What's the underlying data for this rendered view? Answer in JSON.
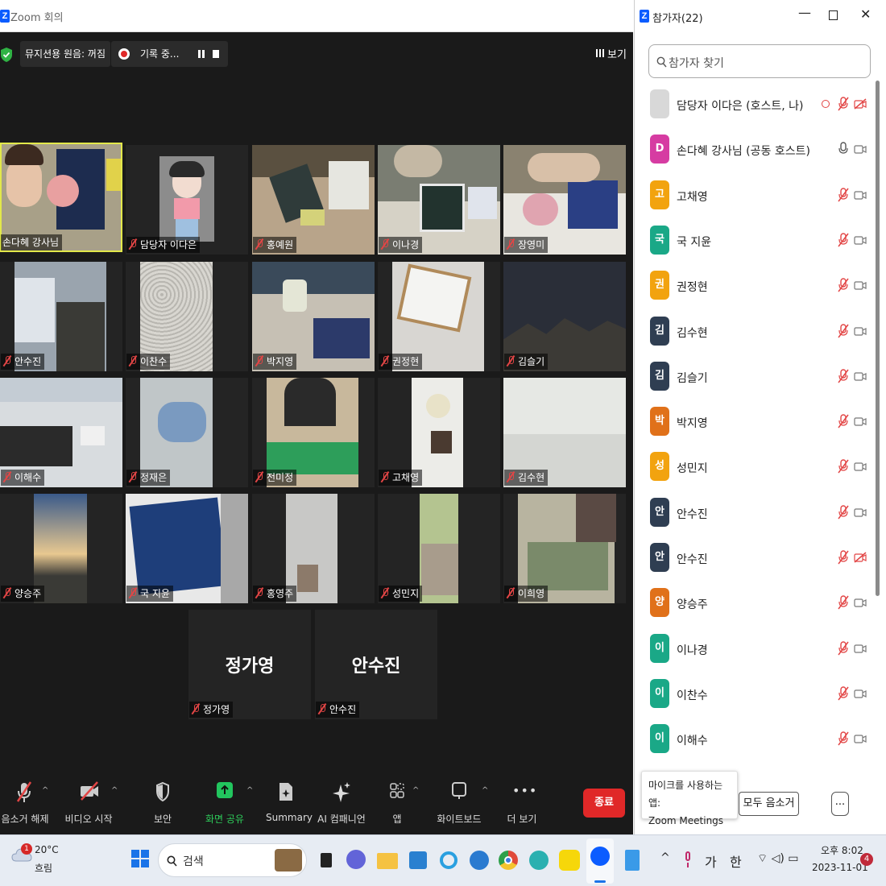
{
  "window": {
    "title": "Zoom 회의",
    "logo_letter": "Z"
  },
  "top_bar": {
    "music_mode": "뮤지션용 원음: 꺼짐",
    "recording": "기록 중...",
    "view": "보기"
  },
  "tiles": [
    {
      "name": "손다혜 강사님"
    },
    {
      "name": "담당자 이다은"
    },
    {
      "name": "홍예원"
    },
    {
      "name": "이나경"
    },
    {
      "name": "장영미"
    },
    {
      "name": "안수진"
    },
    {
      "name": "이찬수"
    },
    {
      "name": "박지영"
    },
    {
      "name": "권정현"
    },
    {
      "name": "김슬기"
    },
    {
      "name": "이해수"
    },
    {
      "name": "정재은"
    },
    {
      "name": "전미정"
    },
    {
      "name": "고채영"
    },
    {
      "name": "김수현"
    },
    {
      "name": "양승주"
    },
    {
      "name": "국 지윤"
    },
    {
      "name": "홍영주"
    },
    {
      "name": "성민지"
    },
    {
      "name": "이희영"
    }
  ],
  "text_tiles": [
    {
      "big": "정가영",
      "name": "정가영"
    },
    {
      "big": "안수진",
      "name": "안수진"
    }
  ],
  "toolbar": {
    "unmute": "음소거 해제",
    "start_video": "비디오 시작",
    "security": "보안",
    "share_screen": "화면 공유",
    "summary": "Summary",
    "ai_companion": "AI 컴패니언",
    "apps": "앱",
    "whiteboard": "화이트보드",
    "more": "더 보기",
    "end": "종료"
  },
  "panel": {
    "title": "참가자(22)",
    "search_placeholder": "참가자 찾기",
    "participants": [
      {
        "avatar": "",
        "name": "담당자 이다은 (호스트, 나)",
        "color": "#bbbbbb"
      },
      {
        "avatar": "D",
        "name": "손다혜 강사님 (공동 호스트)",
        "color": "#d63ca2"
      },
      {
        "avatar": "고",
        "name": "고채영",
        "color": "#f2a30f"
      },
      {
        "avatar": "국",
        "name": "국 지윤",
        "color": "#1aa887"
      },
      {
        "avatar": "권",
        "name": "권정현",
        "color": "#f2a30f"
      },
      {
        "avatar": "김",
        "name": "김수현",
        "color": "#2f3e52"
      },
      {
        "avatar": "김",
        "name": "김슬기",
        "color": "#2f3e52"
      },
      {
        "avatar": "박",
        "name": "박지영",
        "color": "#e0711a"
      },
      {
        "avatar": "성",
        "name": "성민지",
        "color": "#f2a30f"
      },
      {
        "avatar": "안",
        "name": "안수진",
        "color": "#2f3e52"
      },
      {
        "avatar": "안",
        "name": "안수진",
        "color": "#2f3e52"
      },
      {
        "avatar": "양",
        "name": "양승주",
        "color": "#e0711a"
      },
      {
        "avatar": "이",
        "name": "이나경",
        "color": "#1aa887"
      },
      {
        "avatar": "이",
        "name": "이찬수",
        "color": "#1aa887"
      },
      {
        "avatar": "이",
        "name": "이해수",
        "color": "#1aa887"
      }
    ],
    "tooltip_line1": "마이크를 사용하는 앱:",
    "tooltip_line2": "Zoom Meetings",
    "unmute_all": "모두 음소거",
    "more": "..."
  },
  "taskbar": {
    "weather_temp": "20°C",
    "weather_desc": "흐림",
    "weather_badge": "1",
    "search": "검색",
    "ime_ga": "가",
    "ime_han": "한",
    "time": "오후 8:02",
    "date": "2023-11-01",
    "notif_count": "4"
  },
  "icons": [
    "shield-icon",
    "record-icon",
    "pause-icon",
    "stop-icon",
    "grid-icon",
    "mic-muted-icon",
    "video-off-icon",
    "security-icon",
    "share-icon",
    "summary-icon",
    "ai-sparkle-icon",
    "apps-icon",
    "whiteboard-icon",
    "more-icon",
    "search-icon",
    "minimize-icon",
    "maximize-icon",
    "close-icon"
  ]
}
